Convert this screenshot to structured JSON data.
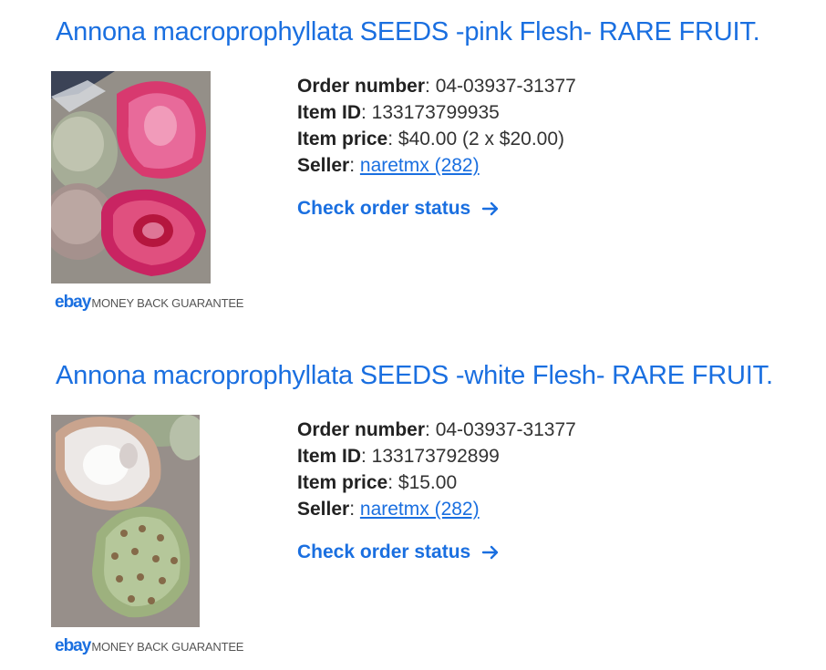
{
  "items": [
    {
      "title": "Annona macroprophyllata SEEDS -pink Flesh- RARE FRUIT.",
      "image": "pink-flesh-annona-fruit-photo",
      "order_number_label": "Order number",
      "order_number": ": 04-03937-31377",
      "item_id_label": "Item ID",
      "item_id": ": 133173799935",
      "item_price_label": "Item price",
      "item_price": ": $40.00 (2 x $20.00)",
      "seller_label": "Seller",
      "seller_sep": ": ",
      "seller": "naretmx (282)",
      "check_status": "Check order status",
      "guarantee_logo": "ebay",
      "guarantee_text": "MONEY BACK GUARANTEE"
    },
    {
      "title": "Annona macroprophyllata SEEDS -white Flesh- RARE FRUIT.",
      "image": "white-flesh-annona-fruit-photo",
      "order_number_label": "Order number",
      "order_number": ": 04-03937-31377",
      "item_id_label": "Item ID",
      "item_id": ": 133173792899",
      "item_price_label": "Item price",
      "item_price": ": $15.00",
      "seller_label": "Seller",
      "seller_sep": ": ",
      "seller": "naretmx (282)",
      "check_status": "Check order status",
      "guarantee_logo": "ebay",
      "guarantee_text": "MONEY BACK GUARANTEE"
    }
  ],
  "colors": {
    "link": "#1a6fe0",
    "text": "#333333",
    "label": "#222222",
    "guarantee_text": "#555555"
  }
}
